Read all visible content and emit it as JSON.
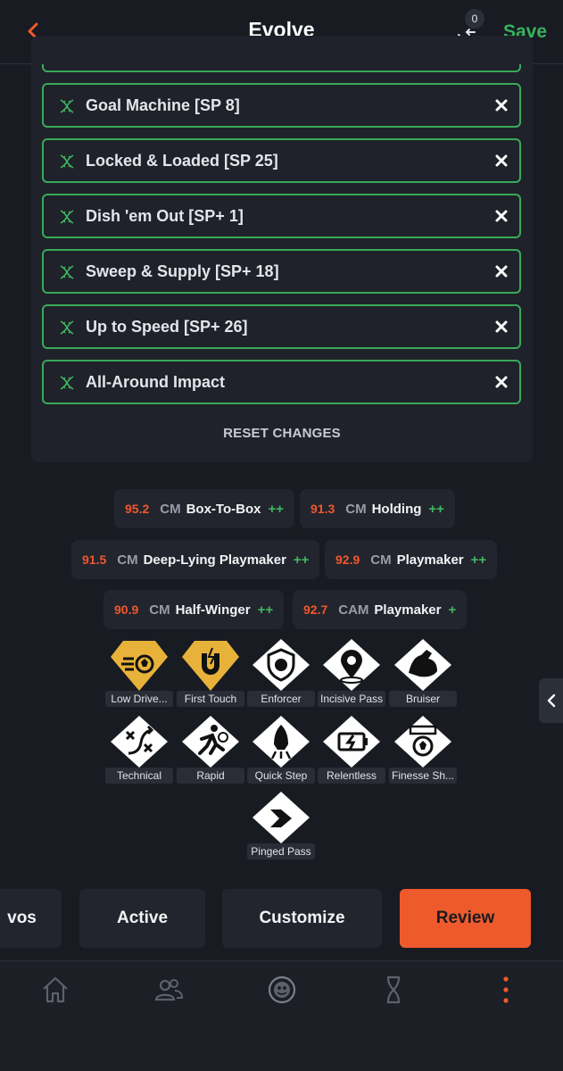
{
  "header": {
    "title": "Evolve",
    "compare_count": "0",
    "save_label": "Save"
  },
  "chips": [
    {
      "label": "Goal Machine [SP 8]"
    },
    {
      "label": "Locked & Loaded [SP 25]"
    },
    {
      "label": "Dish 'em Out [SP+ 1]"
    },
    {
      "label": "Sweep & Supply [SP+ 18]"
    },
    {
      "label": "Up to Speed [SP+ 26]"
    },
    {
      "label": "All-Around Impact"
    }
  ],
  "reset_label": "RESET CHANGES",
  "roles": [
    {
      "rating": "95.2",
      "position": "CM",
      "name": "Box-To-Box",
      "plus": "++"
    },
    {
      "rating": "91.3",
      "position": "CM",
      "name": "Holding",
      "plus": "++"
    },
    {
      "rating": "91.5",
      "position": "CM",
      "name": "Deep-Lying Playmaker",
      "plus": "++"
    },
    {
      "rating": "92.9",
      "position": "CM",
      "name": "Playmaker",
      "plus": "++"
    },
    {
      "rating": "90.9",
      "position": "CM",
      "name": "Half-Winger",
      "plus": "++"
    },
    {
      "rating": "92.7",
      "position": "CAM",
      "name": "Playmaker",
      "plus": "+"
    }
  ],
  "playstyles": [
    {
      "label": "Low Drive...",
      "icon": "low-driven-shot-icon",
      "gold": true
    },
    {
      "label": "First Touch",
      "icon": "first-touch-icon",
      "gold": true
    },
    {
      "label": "Enforcer",
      "icon": "enforcer-icon",
      "gold": false
    },
    {
      "label": "Incisive Pass",
      "icon": "incisive-pass-icon",
      "gold": false
    },
    {
      "label": "Bruiser",
      "icon": "bruiser-icon",
      "gold": false
    },
    {
      "label": "Technical",
      "icon": "technical-icon",
      "gold": false
    },
    {
      "label": "Rapid",
      "icon": "rapid-icon",
      "gold": false
    },
    {
      "label": "Quick Step",
      "icon": "quick-step-icon",
      "gold": false
    },
    {
      "label": "Relentless",
      "icon": "relentless-icon",
      "gold": false
    },
    {
      "label": "Finesse Sh...",
      "icon": "finesse-shot-icon",
      "gold": false
    },
    {
      "label": "Pinged Pass",
      "icon": "pinged-pass-icon",
      "gold": false
    }
  ],
  "tabs": [
    {
      "label": "vos"
    },
    {
      "label": "Active"
    },
    {
      "label": "Customize"
    },
    {
      "label": "Review"
    }
  ],
  "nav": [
    "home-icon",
    "people-icon",
    "club-badge-icon",
    "dna-icon",
    "more-icon"
  ],
  "colors": {
    "accent": "#ef5a2c",
    "green": "#37b35e",
    "gold": "#e8b23a",
    "bg": "#181b22"
  }
}
